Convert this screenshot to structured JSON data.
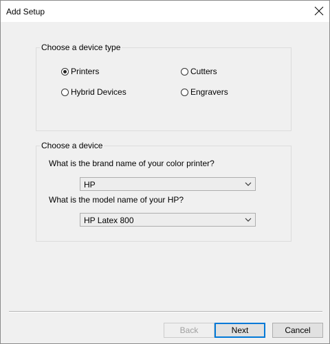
{
  "window": {
    "title": "Add Setup"
  },
  "device_type": {
    "label": "Choose a device type",
    "options": [
      {
        "label": "Printers",
        "checked": true
      },
      {
        "label": "Cutters",
        "checked": false
      },
      {
        "label": "Hybrid Devices",
        "checked": false
      },
      {
        "label": "Engravers",
        "checked": false
      }
    ]
  },
  "device": {
    "label": "Choose a device",
    "brand_prompt": "What is the brand name of your color printer?",
    "brand_value": "HP",
    "model_prompt": "What is the model name of your HP?",
    "model_value": "HP Latex 800"
  },
  "footer": {
    "back_label": "Back",
    "next_label": "Next",
    "cancel_label": "Cancel"
  },
  "colors": {
    "accent": "#0078d7",
    "dialog_bg": "#f0f0f0"
  }
}
